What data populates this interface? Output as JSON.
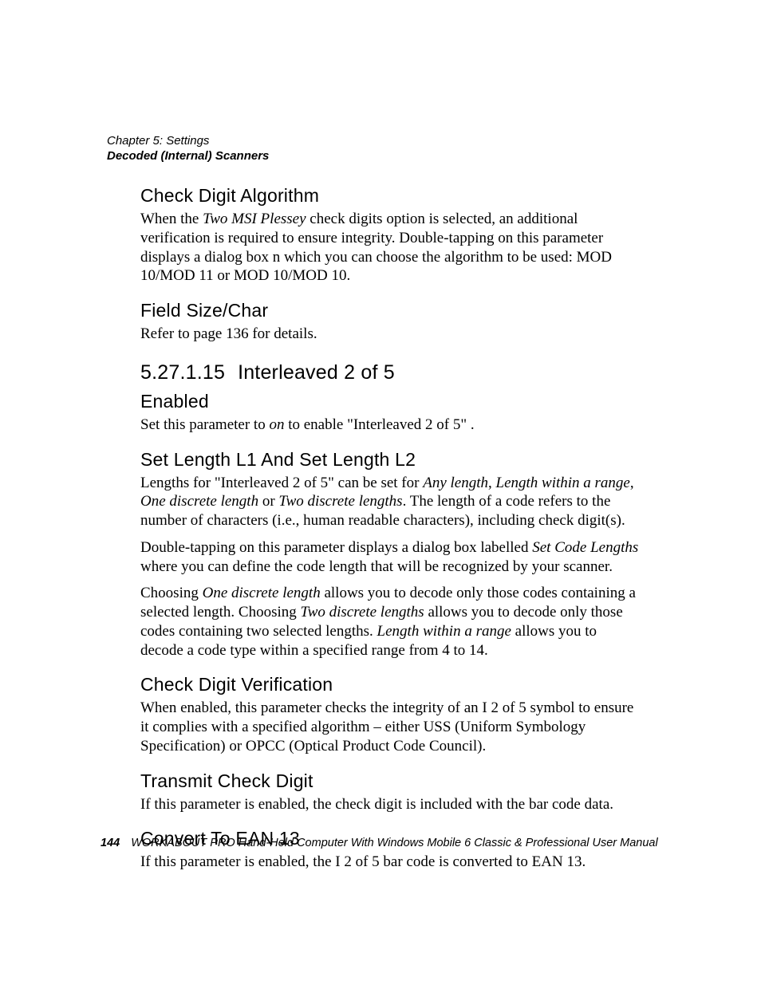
{
  "header": {
    "chapter": "Chapter 5: Settings",
    "section": "Decoded (Internal) Scanners"
  },
  "s1": {
    "title": "Check Digit Algorithm",
    "p1a": "When the ",
    "p1em": "Two MSI Plessey",
    "p1b": " check digits option is selected, an additional verification is required to ensure integrity. Double-tapping on this parameter displays a dialog box n which you can choose the algorithm to be used:  MOD 10/MOD 11 or MOD 10/MOD 10."
  },
  "s2": {
    "title": "Field Size/Char",
    "p1": "Refer to page 136 for details."
  },
  "s3": {
    "num": "5.27.1.15",
    "title": "Interleaved 2 of 5"
  },
  "s4": {
    "title": "Enabled",
    "p1a": "Set this parameter to ",
    "p1em": "on",
    "p1b": " to enable \"Interleaved 2 of 5\" ."
  },
  "s5": {
    "title": "Set Length L1 And Set Length L2",
    "p1a": "Lengths for \"Interleaved 2 of 5\" can be set for ",
    "p1e1": "Any length",
    "p1c1": ", ",
    "p1e2": "Length within a range",
    "p1c2": ", ",
    "p1e3": "One discrete length",
    "p1c3": " or ",
    "p1e4": "Two discrete lengths",
    "p1b": ". The length of a code refers to the number of characters (i.e., human readable characters), including check digit(s).",
    "p2a": "Double-tapping on this parameter displays a dialog box labelled ",
    "p2em": "Set Code Lengths",
    "p2b": " where you can define the code length that will be recognized by your scanner.",
    "p3a": "Choosing ",
    "p3e1": "One discrete length",
    "p3c1": " allows you to decode only those codes containing a selected length. Choosing ",
    "p3e2": "Two discrete lengths",
    "p3c2": " allows you to decode only those codes containing two selected lengths. ",
    "p3e3": "Length within a range",
    "p3b": " allows you to decode a code type within a specified range from 4 to 14."
  },
  "s6": {
    "title": "Check Digit Verification",
    "p1": "When enabled, this parameter checks the integrity of an I 2 of 5 symbol to ensure it complies with a specified algorithm – either USS (Uniform Symbology Specification) or OPCC (Optical Product Code Council)."
  },
  "s7": {
    "title": "Transmit Check Digit",
    "p1": "If this parameter is enabled, the check digit is included with the bar code data."
  },
  "s8": {
    "title": "Convert To EAN 13",
    "p1": "If this parameter is enabled, the I 2 of 5 bar code is converted to EAN 13."
  },
  "footer": {
    "page": "144",
    "text": "WORKABOUT PRO Hand-Held Computer With Windows Mobile 6 Classic & Professional User Manual"
  }
}
